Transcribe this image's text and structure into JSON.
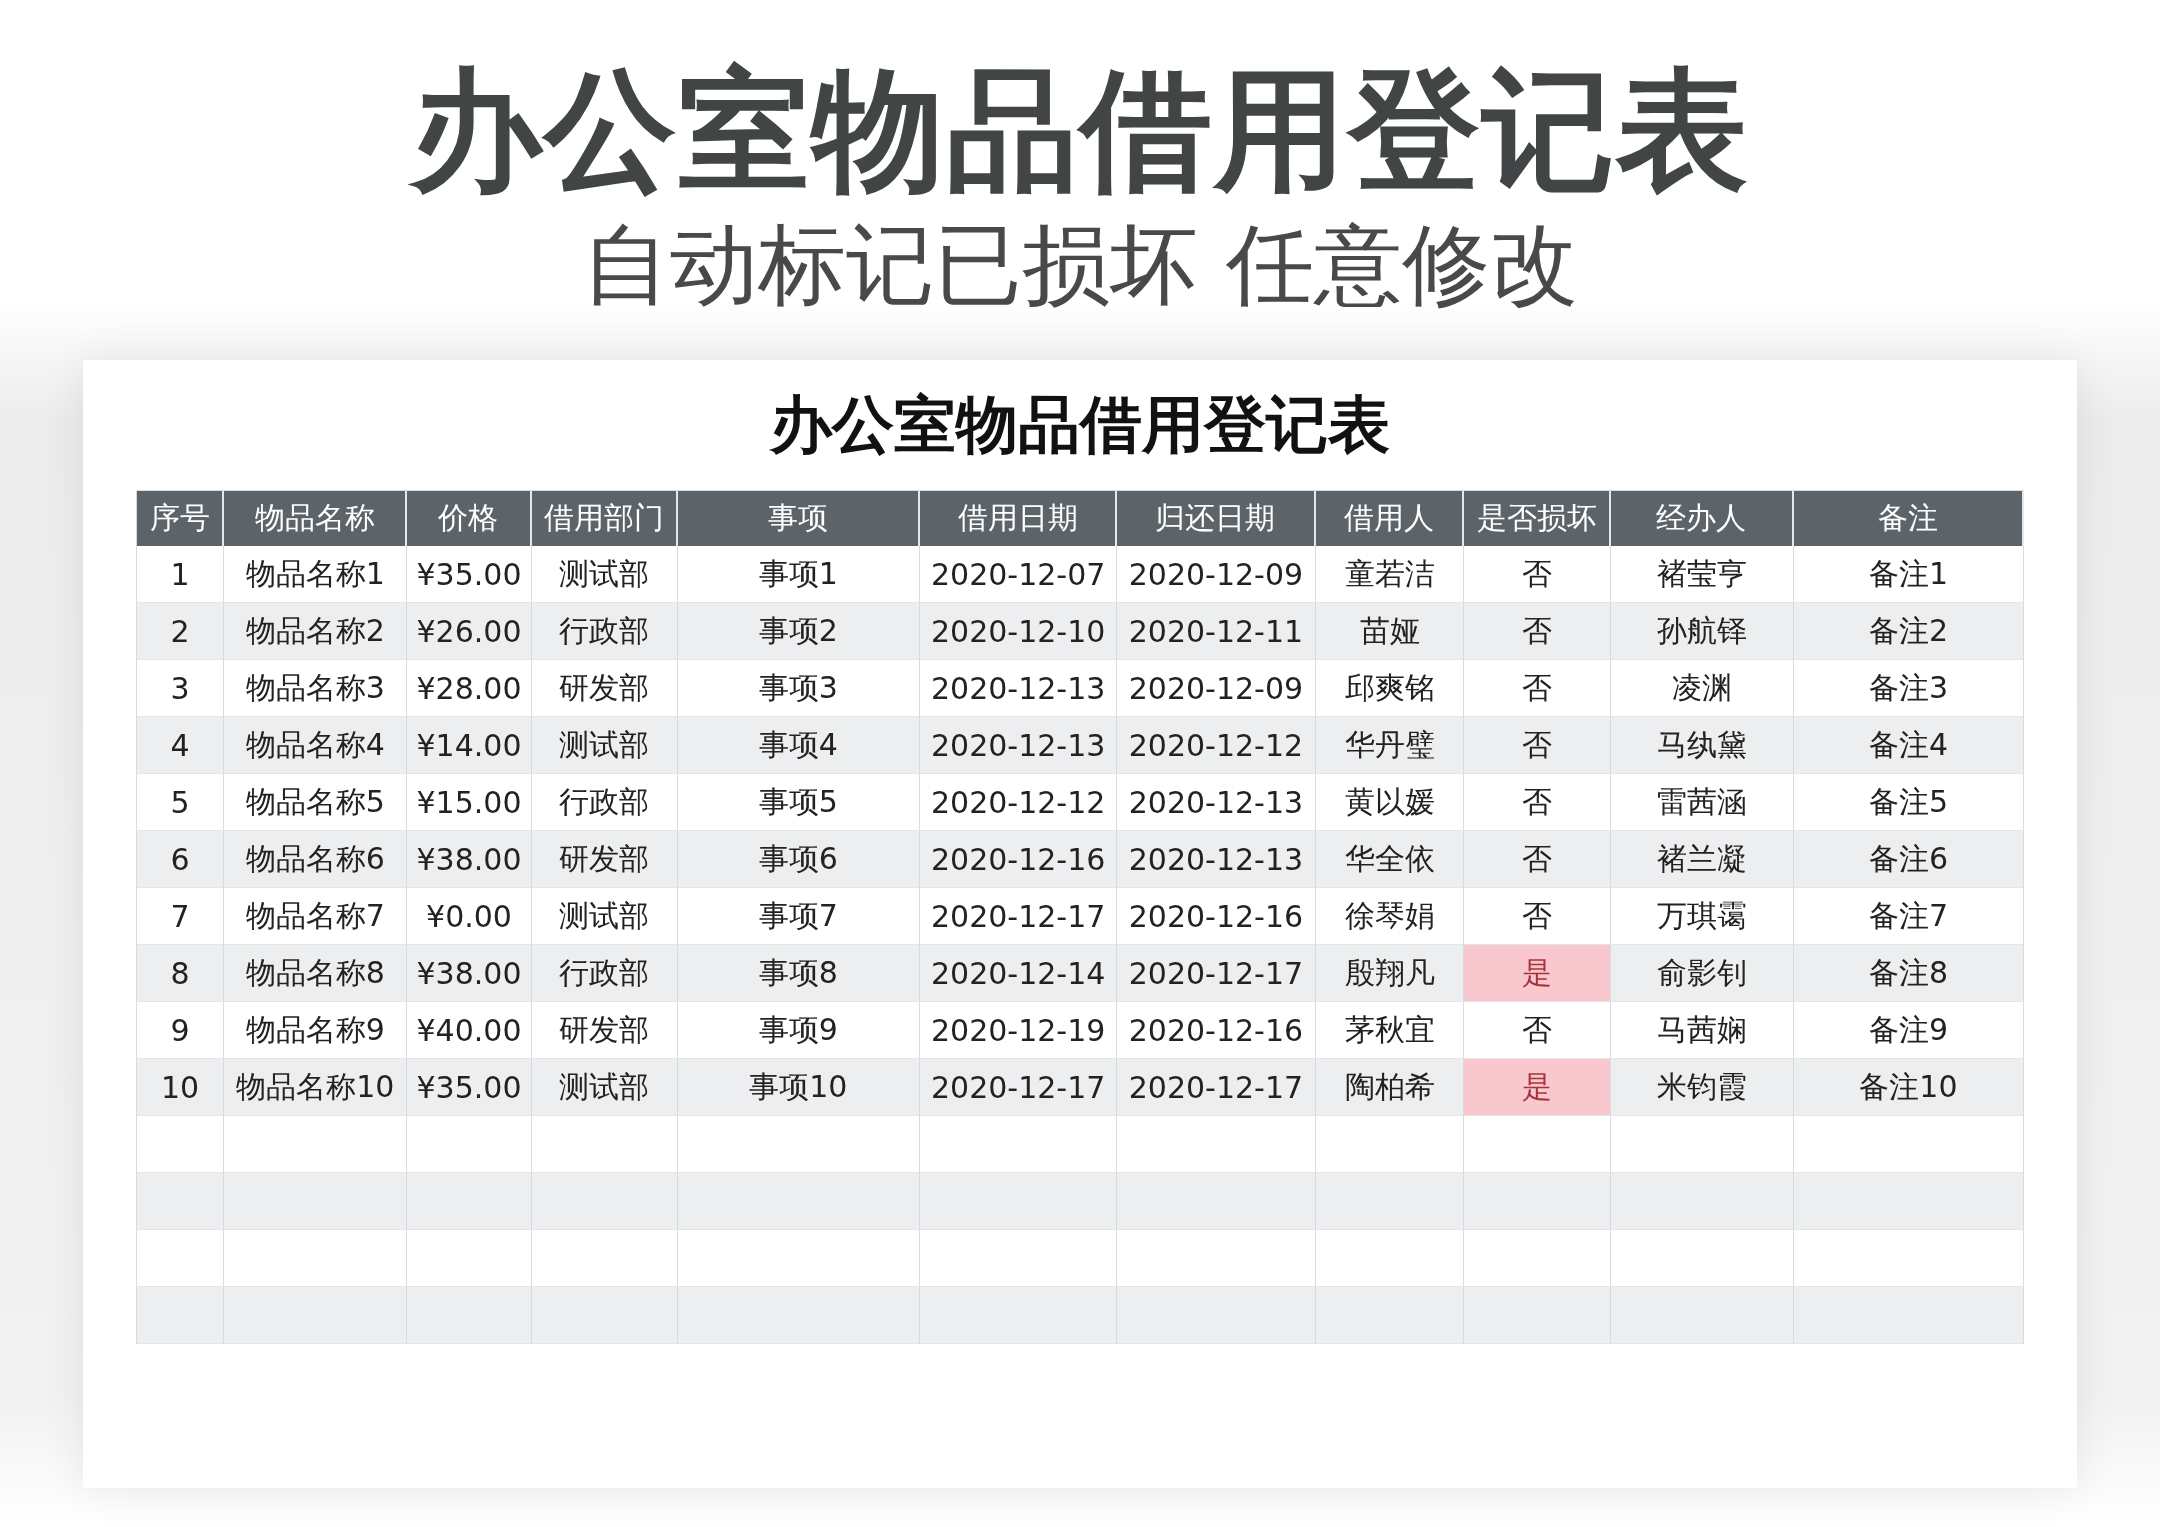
{
  "headline": "办公室物品借用登记表",
  "subheadline": "自动标记已损坏 任意修改",
  "sheet": {
    "title": "办公室物品借用登记表",
    "columns": [
      "序号",
      "物品名称",
      "价格",
      "借用部门",
      "事项",
      "借用日期",
      "归还日期",
      "借用人",
      "是否损坏",
      "经办人",
      "备注"
    ],
    "rows": [
      {
        "no": "1",
        "item": "物品名称1",
        "price": "¥35.00",
        "dept": "测试部",
        "matter": "事项1",
        "borrow_date": "2020-12-07",
        "return_date": "2020-12-09",
        "borrower": "童若洁",
        "damaged_text": "否",
        "damaged": false,
        "handler": "褚莹亨",
        "note": "备注1"
      },
      {
        "no": "2",
        "item": "物品名称2",
        "price": "¥26.00",
        "dept": "行政部",
        "matter": "事项2",
        "borrow_date": "2020-12-10",
        "return_date": "2020-12-11",
        "borrower": "苗娅",
        "damaged_text": "否",
        "damaged": false,
        "handler": "孙航铎",
        "note": "备注2"
      },
      {
        "no": "3",
        "item": "物品名称3",
        "price": "¥28.00",
        "dept": "研发部",
        "matter": "事项3",
        "borrow_date": "2020-12-13",
        "return_date": "2020-12-09",
        "borrower": "邱爽铭",
        "damaged_text": "否",
        "damaged": false,
        "handler": "凌渊",
        "note": "备注3"
      },
      {
        "no": "4",
        "item": "物品名称4",
        "price": "¥14.00",
        "dept": "测试部",
        "matter": "事项4",
        "borrow_date": "2020-12-13",
        "return_date": "2020-12-12",
        "borrower": "华丹璧",
        "damaged_text": "否",
        "damaged": false,
        "handler": "马纨黛",
        "note": "备注4"
      },
      {
        "no": "5",
        "item": "物品名称5",
        "price": "¥15.00",
        "dept": "行政部",
        "matter": "事项5",
        "borrow_date": "2020-12-12",
        "return_date": "2020-12-13",
        "borrower": "黄以媛",
        "damaged_text": "否",
        "damaged": false,
        "handler": "雷茜涵",
        "note": "备注5"
      },
      {
        "no": "6",
        "item": "物品名称6",
        "price": "¥38.00",
        "dept": "研发部",
        "matter": "事项6",
        "borrow_date": "2020-12-16",
        "return_date": "2020-12-13",
        "borrower": "华全依",
        "damaged_text": "否",
        "damaged": false,
        "handler": "褚兰凝",
        "note": "备注6"
      },
      {
        "no": "7",
        "item": "物品名称7",
        "price": "¥0.00",
        "dept": "测试部",
        "matter": "事项7",
        "borrow_date": "2020-12-17",
        "return_date": "2020-12-16",
        "borrower": "徐琴娟",
        "damaged_text": "否",
        "damaged": false,
        "handler": "万琪霭",
        "note": "备注7"
      },
      {
        "no": "8",
        "item": "物品名称8",
        "price": "¥38.00",
        "dept": "行政部",
        "matter": "事项8",
        "borrow_date": "2020-12-14",
        "return_date": "2020-12-17",
        "borrower": "殷翔凡",
        "damaged_text": "是",
        "damaged": true,
        "handler": "俞影钊",
        "note": "备注8"
      },
      {
        "no": "9",
        "item": "物品名称9",
        "price": "¥40.00",
        "dept": "研发部",
        "matter": "事项9",
        "borrow_date": "2020-12-19",
        "return_date": "2020-12-16",
        "borrower": "茅秋宜",
        "damaged_text": "否",
        "damaged": false,
        "handler": "马茜娴",
        "note": "备注9"
      },
      {
        "no": "10",
        "item": "物品名称10",
        "price": "¥35.00",
        "dept": "测试部",
        "matter": "事项10",
        "borrow_date": "2020-12-17",
        "return_date": "2020-12-17",
        "borrower": "陶柏希",
        "damaged_text": "是",
        "damaged": true,
        "handler": "米钧霞",
        "note": "备注10"
      }
    ]
  }
}
